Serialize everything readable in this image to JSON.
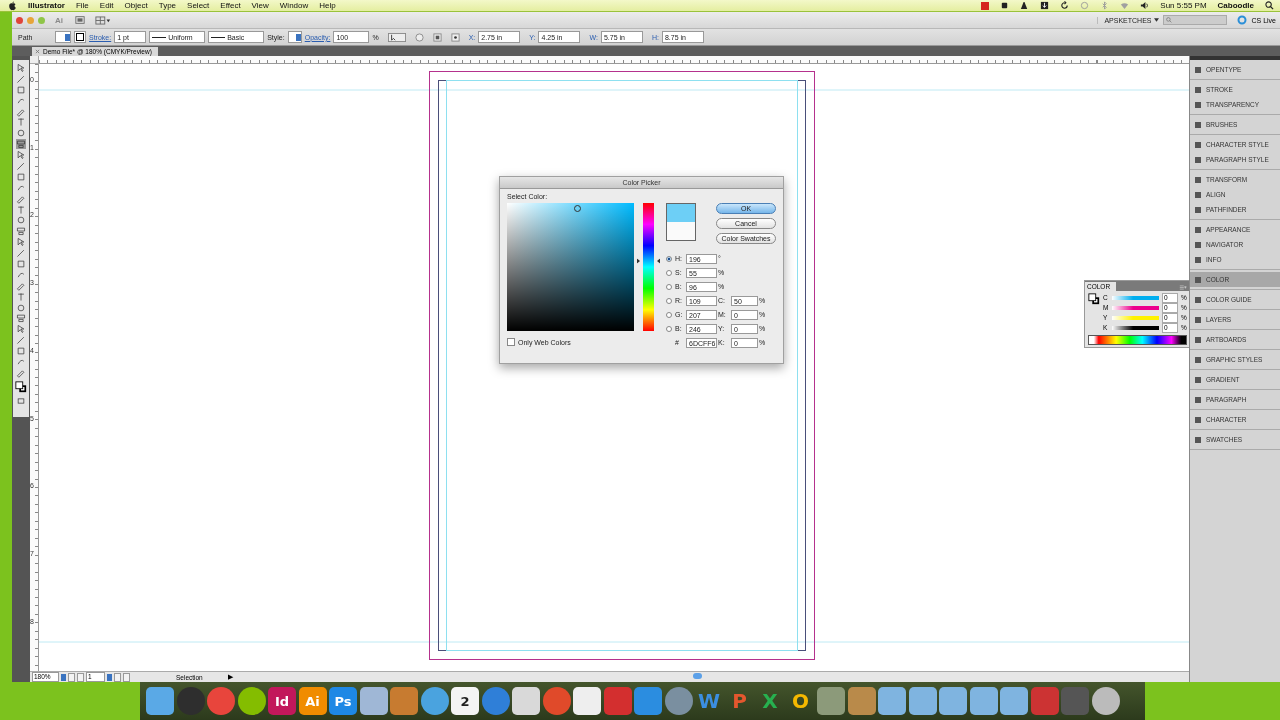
{
  "menu_bar": {
    "app_name": "Illustrator",
    "items": [
      "File",
      "Edit",
      "Object",
      "Type",
      "Select",
      "Effect",
      "View",
      "Window",
      "Help"
    ],
    "clock": "Sun 5:55 PM",
    "user": "Caboodle"
  },
  "title_bar": {
    "app_badge": "Ai",
    "workspace": "APSKETCHES",
    "cs_live": "CS Live"
  },
  "control_bar": {
    "selection_label": "Path",
    "stroke_label": "Stroke:",
    "stroke_weight": "1 pt",
    "profile": "Uniform",
    "brush": "Basic",
    "style_label": "Style:",
    "opacity_label": "Opacity:",
    "opacity": "100",
    "opacity_unit": "%",
    "transform": [
      {
        "label": "X:",
        "value": "2.75 in"
      },
      {
        "label": "Y:",
        "value": "4.25 in"
      },
      {
        "label": "W:",
        "value": "5.75 in"
      },
      {
        "label": "H:",
        "value": "8.75 in"
      }
    ]
  },
  "document_tab": "Demo File* @ 180% (CMYK/Preview)",
  "tools": [
    {
      "selected": false
    },
    {
      "selected": false
    },
    {
      "selected": false
    },
    {
      "selected": false
    },
    {
      "selected": false
    },
    {
      "selected": false
    },
    {
      "selected": false
    },
    {
      "selected": true
    },
    {
      "selected": false
    },
    {
      "selected": false
    },
    {
      "selected": false
    },
    {
      "selected": false
    },
    {
      "selected": false
    },
    {
      "selected": false
    },
    {
      "selected": false
    },
    {
      "selected": false
    },
    {
      "selected": false
    },
    {
      "selected": false
    },
    {
      "selected": false
    },
    {
      "selected": false
    },
    {
      "selected": false
    },
    {
      "selected": false
    },
    {
      "selected": false
    },
    {
      "selected": false
    },
    {
      "selected": false
    },
    {
      "selected": false
    },
    {
      "selected": false
    },
    {
      "selected": false
    },
    {
      "selected": false
    }
  ],
  "vertical_ruler": [
    "0",
    "1",
    "2",
    "3",
    "4",
    "5",
    "6",
    "7",
    "8"
  ],
  "color_picker": {
    "title": "Color Picker",
    "prompt": "Select Color:",
    "hsb": [
      {
        "label": "H:",
        "value": "196",
        "unit": "°",
        "selected": true
      },
      {
        "label": "S:",
        "value": "55",
        "unit": "%",
        "selected": false
      },
      {
        "label": "B:",
        "value": "96",
        "unit": "%",
        "selected": false
      }
    ],
    "rgb": [
      {
        "label": "R:",
        "value": "109",
        "selected": false
      },
      {
        "label": "G:",
        "value": "207",
        "selected": false
      },
      {
        "label": "B:",
        "value": "246",
        "selected": false
      }
    ],
    "cmyk": [
      {
        "label": "C:",
        "value": "50",
        "unit": "%"
      },
      {
        "label": "M:",
        "value": "0",
        "unit": "%"
      },
      {
        "label": "Y:",
        "value": "0",
        "unit": "%"
      },
      {
        "label": "K:",
        "value": "0",
        "unit": "%"
      }
    ],
    "hex_label": "#",
    "hex": "6DCFF6",
    "buttons": [
      {
        "label": "OK",
        "default": true
      },
      {
        "label": "Cancel",
        "default": false
      },
      {
        "label": "Color Swatches",
        "default": false
      }
    ],
    "web_only": {
      "label": "Only Web Colors",
      "checked": false
    }
  },
  "color_panel": {
    "tab": "COLOR",
    "channels": [
      {
        "label": "C",
        "value": "0",
        "unit": "%",
        "color": "#00aeef"
      },
      {
        "label": "M",
        "value": "0",
        "unit": "%",
        "color": "#ec008c"
      },
      {
        "label": "Y",
        "value": "0",
        "unit": "%",
        "color": "#fff200"
      },
      {
        "label": "K",
        "value": "0",
        "unit": "%",
        "color": "#000000"
      }
    ]
  },
  "panel_dock": [
    {
      "items": [
        {
          "label": "OPENTYPE",
          "selected": false
        }
      ]
    },
    {
      "items": [
        {
          "label": "STROKE",
          "selected": false
        },
        {
          "label": "TRANSPARENCY",
          "selected": false
        }
      ]
    },
    {
      "items": [
        {
          "label": "BRUSHES",
          "selected": false
        }
      ]
    },
    {
      "items": [
        {
          "label": "CHARACTER STYLE",
          "selected": false
        },
        {
          "label": "PARAGRAPH STYLE",
          "selected": false
        }
      ]
    },
    {
      "items": [
        {
          "label": "TRANSFORM",
          "selected": false
        },
        {
          "label": "ALIGN",
          "selected": false
        },
        {
          "label": "PATHFINDER",
          "selected": false
        }
      ]
    },
    {
      "items": [
        {
          "label": "APPEARANCE",
          "selected": false
        },
        {
          "label": "NAVIGATOR",
          "selected": false
        },
        {
          "label": "INFO",
          "selected": false
        }
      ]
    },
    {
      "items": [
        {
          "label": "COLOR",
          "selected": true
        }
      ]
    },
    {
      "items": [
        {
          "label": "COLOR GUIDE",
          "selected": false
        }
      ]
    },
    {
      "items": [
        {
          "label": "LAYERS",
          "selected": false
        }
      ]
    },
    {
      "items": [
        {
          "label": "ARTBOARDS",
          "selected": false
        }
      ]
    },
    {
      "items": [
        {
          "label": "GRAPHIC STYLES",
          "selected": false
        }
      ]
    },
    {
      "items": [
        {
          "label": "GRADIENT",
          "selected": false
        }
      ]
    },
    {
      "items": [
        {
          "label": "PARAGRAPH",
          "selected": false
        }
      ]
    },
    {
      "items": [
        {
          "label": "CHARACTER",
          "selected": false
        }
      ]
    },
    {
      "items": [
        {
          "label": "SWATCHES",
          "selected": false
        }
      ]
    }
  ],
  "status_bar": {
    "zoom": "180%",
    "artboard": "1",
    "tool": "Selection",
    "arrow": "▶"
  },
  "dock": [
    {
      "kind": "tile",
      "color": "#5aa9e6"
    },
    {
      "kind": "round",
      "color": "#2e2e2e"
    },
    {
      "kind": "round",
      "color": "#e8453c"
    },
    {
      "kind": "round",
      "color": "#84bd00"
    },
    {
      "kind": "tile",
      "color": "#c2185b",
      "label": "Id"
    },
    {
      "kind": "tile",
      "color": "#f08c00",
      "label": "Ai"
    },
    {
      "kind": "tile",
      "color": "#1e88e5",
      "label": "Ps"
    },
    {
      "kind": "tile",
      "color": "#9fb7d6"
    },
    {
      "kind": "tile",
      "color": "#c77b30"
    },
    {
      "kind": "round",
      "color": "#4aa3df"
    },
    {
      "kind": "tile",
      "color": "#f4f4f4",
      "label": "2"
    },
    {
      "kind": "round",
      "color": "#2f7fd8"
    },
    {
      "kind": "tile",
      "color": "#d9d9d9"
    },
    {
      "kind": "round",
      "color": "#e04a2a"
    },
    {
      "kind": "tile",
      "color": "#eeeeee"
    },
    {
      "kind": "tile",
      "color": "#d32f2f"
    },
    {
      "kind": "tile",
      "color": "#2b8de0"
    },
    {
      "kind": "round",
      "color": "#7a8fa0"
    },
    {
      "kind": "letter",
      "color": "#3b8ee0",
      "label": "W"
    },
    {
      "kind": "letter",
      "color": "#e4572e",
      "label": "P"
    },
    {
      "kind": "letter",
      "color": "#27b04f",
      "label": "X"
    },
    {
      "kind": "letter",
      "color": "#f5b800",
      "label": "O"
    },
    {
      "kind": "tile",
      "color": "#8c9a7a"
    },
    {
      "kind": "tile",
      "color": "#b98a4a"
    },
    {
      "kind": "tile",
      "color": "#7fb4e0"
    },
    {
      "kind": "tile",
      "color": "#7fb4e0"
    },
    {
      "kind": "tile",
      "color": "#7fb4e0"
    },
    {
      "kind": "tile",
      "color": "#7fb4e0"
    },
    {
      "kind": "tile",
      "color": "#7fb4e0"
    },
    {
      "kind": "tile",
      "color": "#cc3333"
    },
    {
      "kind": "tile",
      "color": "#555555"
    },
    {
      "kind": "round",
      "color": "#bbbbbb"
    }
  ]
}
